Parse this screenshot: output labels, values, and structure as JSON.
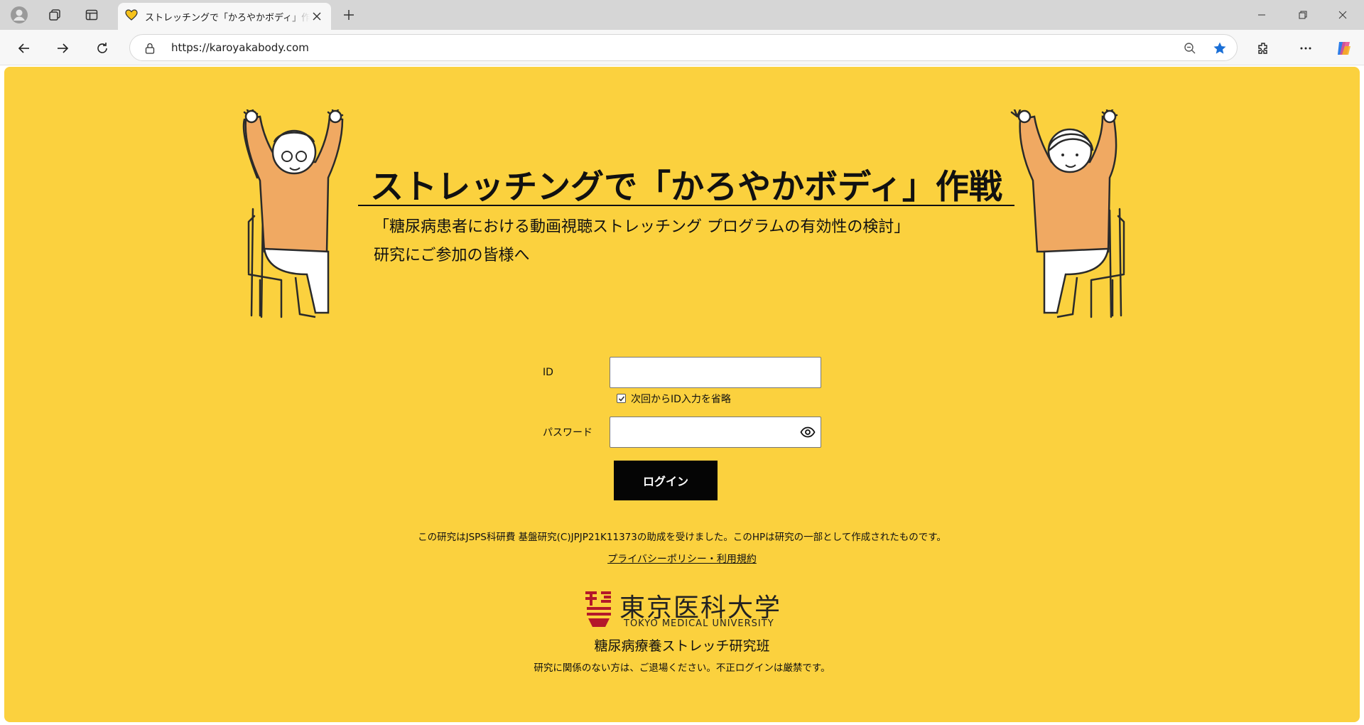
{
  "browser": {
    "tab_title": "ストレッチングで「かろやかボディ」作戦",
    "url": "https://karoyakabody.com"
  },
  "page": {
    "title": "ストレッチングで「かろやかボディ」作戦",
    "subtitle_line1": "「糖尿病患者における動画視聴ストレッチング プログラムの有効性の検討」",
    "subtitle_line2": "研究にご参加の皆様へ",
    "background_color": "#fbd13e"
  },
  "login_form": {
    "id_label": "ID",
    "id_value": "",
    "remember_label": "次回からID入力を省略",
    "remember_checked": true,
    "password_label": "パスワード",
    "password_value": "",
    "login_button": "ログイン"
  },
  "footer": {
    "grant_note": "この研究はJSPS科研費 基盤研究(C)JPJP21K11373の助成を受けました。このHPは研究の一部として作成されたものです。",
    "privacy_link": "プライバシーポリシー・利用規約",
    "university_name": "東京医科大学",
    "university_name_en": "TOKYO MEDICAL UNIVERSITY",
    "group_name": "糖尿病療養ストレッチ研究班",
    "warning": "研究に関係のない方は、ご退場ください。不正ログインは厳禁です。"
  }
}
